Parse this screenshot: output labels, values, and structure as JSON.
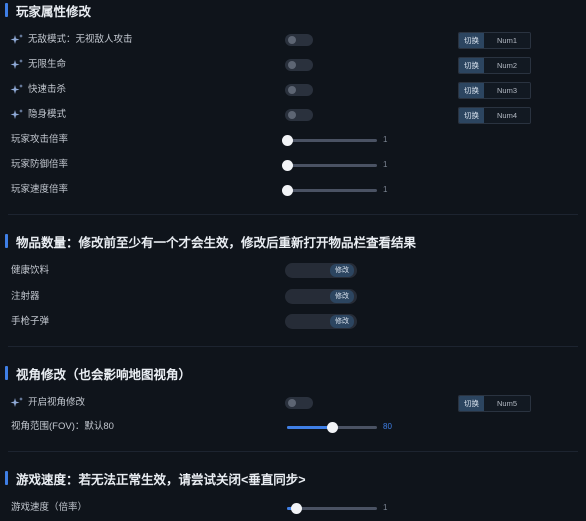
{
  "player": {
    "title": "玩家属性修改",
    "toggles": [
      {
        "label": "无敌模式：无视敌人攻击",
        "switch_label": "切换",
        "hotkey": "Num1"
      },
      {
        "label": "无限生命",
        "switch_label": "切换",
        "hotkey": "Num2"
      },
      {
        "label": "快速击杀",
        "switch_label": "切换",
        "hotkey": "Num3"
      },
      {
        "label": "隐身模式",
        "switch_label": "切换",
        "hotkey": "Num4"
      }
    ],
    "sliders": [
      {
        "label": "玩家攻击倍率",
        "value": "1",
        "fraction": 0.0
      },
      {
        "label": "玩家防御倍率",
        "value": "1",
        "fraction": 0.0
      },
      {
        "label": "玩家速度倍率",
        "value": "1",
        "fraction": 0.0
      }
    ]
  },
  "items": {
    "title": "物品数量：修改前至少有一个才会生效，修改后重新打开物品栏查看结果",
    "rows": [
      {
        "label": "健康饮料",
        "button": "修改"
      },
      {
        "label": "注射器",
        "button": "修改"
      },
      {
        "label": "手枪子弹",
        "button": "修改"
      }
    ]
  },
  "view": {
    "title": "视角修改（也会影响地图视角）",
    "toggle": {
      "label": "开启视角修改",
      "switch_label": "切换",
      "hotkey": "Num5"
    },
    "slider": {
      "label": "视角范围(FOV)：默认80",
      "value": "80",
      "fraction": 0.5
    }
  },
  "speed": {
    "title": "游戏速度：若无法正常生效，请尝试关闭<垂直同步>",
    "slider": {
      "label": "游戏速度（倍率）",
      "value": "1",
      "fraction": 0.1
    }
  },
  "colors": {
    "accent": "#3f7fe6",
    "background": "#0f141b"
  }
}
